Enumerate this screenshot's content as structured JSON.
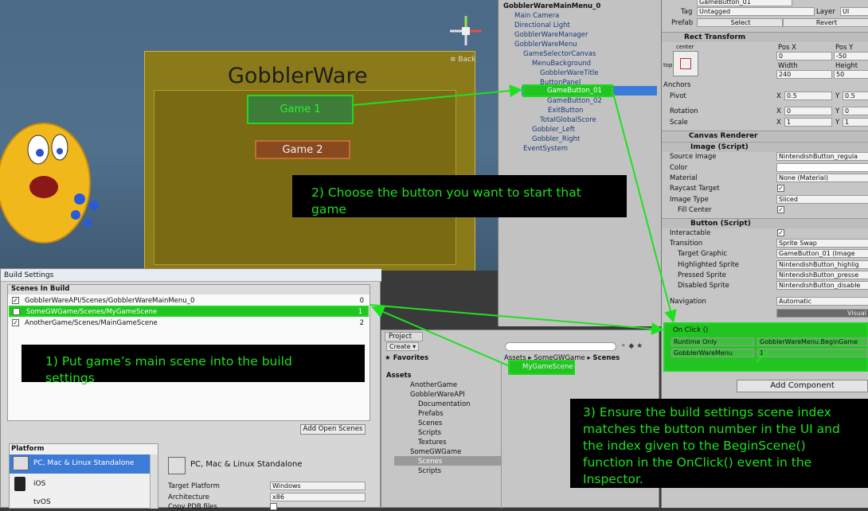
{
  "scene_view": {
    "title": "GobblerWare",
    "game_buttons": [
      "Game 1",
      "Game 2"
    ],
    "back_label": "≡ Back"
  },
  "hierarchy": {
    "root": "GobblerWareMainMenu_0",
    "items": [
      "Main Camera",
      "Directional Light",
      "GobblerWareManager",
      "GobblerWareMenu",
      "GameSelectorCanvas",
      "MenuBackground",
      "GobblerWareTitle",
      "ButtonPanel",
      "GameButton_01",
      "GameButton_02",
      "ExitButton",
      "TotalGlobalScore",
      "Gobbler_Left",
      "Gobbler_Right",
      "EventSystem"
    ]
  },
  "inspector": {
    "object_name": "GameButton_01",
    "tag_label": "Tag",
    "tag_value": "Untagged",
    "layer_label": "Layer",
    "layer_value": "UI",
    "prefab_label": "Prefab",
    "select_label": "Select",
    "revert_label": "Revert",
    "rect_transform": "Rect Transform",
    "anchor_preset": "center",
    "anchor_side": "top",
    "pos_x_label": "Pos X",
    "pos_y_label": "Pos Y",
    "pos_x": "0",
    "pos_y": "-50",
    "width_label": "Width",
    "height_label": "Height",
    "width": "240",
    "height": "50",
    "anchors_label": "Anchors",
    "pivot_label": "Pivot",
    "pivot_x": "0.5",
    "pivot_y": "0.5",
    "rotation_label": "Rotation",
    "rot_x": "0",
    "rot_y": "0",
    "scale_label": "Scale",
    "scale_x": "1",
    "scale_y": "1",
    "x_label": "X",
    "y_label": "Y",
    "canvas_renderer": "Canvas Renderer",
    "image_script": "Image (Script)",
    "source_image_label": "Source Image",
    "source_image": "NintendishButton_regula",
    "color_label": "Color",
    "material_label": "Material",
    "material": "None (Material)",
    "raycast_label": "Raycast Target",
    "image_type_label": "Image Type",
    "image_type": "Sliced",
    "fill_center_label": "Fill Center",
    "button_script": "Button (Script)",
    "interactable_label": "Interactable",
    "transition_label": "Transition",
    "transition": "Sprite Swap",
    "target_graphic_label": "Target Graphic",
    "target_graphic": "GameButton_01 (Image",
    "highlighted_label": "Highlighted Sprite",
    "highlighted": "NintendishButton_highlig",
    "pressed_label": "Pressed Sprite",
    "pressed": "NintendishButton_presse",
    "disabled_label": "Disabled Sprite",
    "disabled": "NintendishButton_disable",
    "navigation_label": "Navigation",
    "navigation": "Automatic",
    "visualize": "Visual",
    "onclick_title": "On Click ()",
    "runtime": "Runtime Only",
    "function": "GobblerWareMenu.BeginGame",
    "target_object": "GobblerWareMenu",
    "argument": "1",
    "add_component": "Add Component"
  },
  "build_settings": {
    "window_title": "Build Settings",
    "scenes_header": "Scenes In Build",
    "scenes": [
      {
        "path": "GobblerWareAPI/Scenes/GobblerWareMainMenu_0",
        "index": "0"
      },
      {
        "path": "SomeGWGame/Scenes/MyGameScene",
        "index": "1"
      },
      {
        "path": "AnotherGame/Scenes/MainGameScene",
        "index": "2"
      }
    ],
    "add_open_scenes": "Add Open Scenes",
    "platform_header": "Platform",
    "platforms": [
      "PC, Mac & Linux Standalone",
      "iOS",
      "tvOS"
    ],
    "selected_platform": "PC, Mac & Linux Standalone",
    "target_platform_label": "Target Platform",
    "target_platform": "Windows",
    "architecture_label": "Architecture",
    "architecture": "x86",
    "copy_pdb_label": "Copy PDB files"
  },
  "project": {
    "tab": "Project",
    "create": "Create ▾",
    "favorites": "Favorites",
    "breadcrumb": [
      "Assets",
      "SomeGWGame",
      "Scenes"
    ],
    "tree": [
      "Assets",
      "AnotherGame",
      "GobblerWareAPI",
      "Documentation",
      "Prefabs",
      "Scenes",
      "Scripts",
      "Textures",
      "SomeGWGame",
      "Scenes",
      "Scripts"
    ],
    "selected_asset": "MyGameScene"
  },
  "notes": {
    "note1": "1) Put game’s main scene into the build settings",
    "note2": "2) Choose the button you want to start that game",
    "note3": "3) Ensure the build settings scene index matches the button number in the UI and the index given to the BeginScene() function in the OnClick() event in the Inspector."
  },
  "colors": {
    "highlight": "#22c422",
    "note_text": "#1fe01f",
    "selection": "#3d7bd8"
  }
}
